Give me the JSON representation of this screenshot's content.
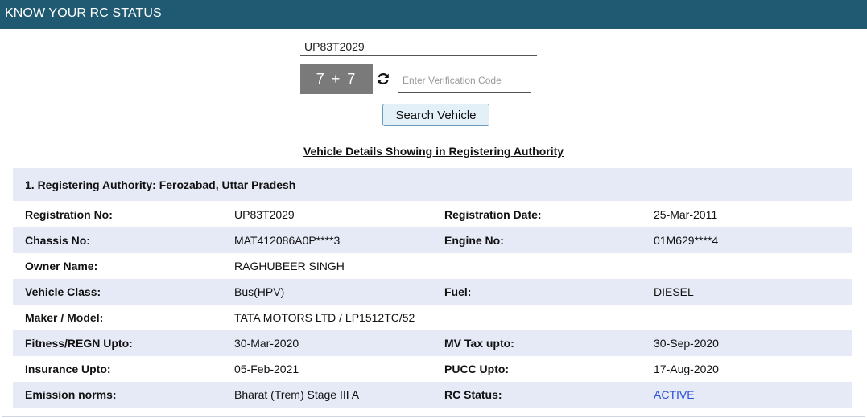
{
  "header": {
    "title": "KNOW YOUR RC STATUS"
  },
  "search": {
    "registration_value": "UP83T2029",
    "captcha_text": "7 + 7",
    "verification_placeholder": "Enter Verification Code",
    "button_label": "Search Vehicle"
  },
  "details": {
    "title": "Vehicle Details Showing in Registering Authority",
    "authority": "1. Registering Authority: Ferozabad, Uttar Pradesh",
    "rows": [
      {
        "l1": "Registration No:",
        "v1": "UP83T2029",
        "l2": "Registration Date:",
        "v2": "25-Mar-2011"
      },
      {
        "l1": "Chassis No:",
        "v1": "MAT412086A0P****3",
        "l2": "Engine No:",
        "v2": "01M629****4"
      },
      {
        "l1": "Owner Name:",
        "v1": "RAGHUBEER SINGH",
        "l2": "",
        "v2": ""
      },
      {
        "l1": "Vehicle Class:",
        "v1": "Bus(HPV)",
        "l2": "Fuel:",
        "v2": "DIESEL"
      },
      {
        "l1": "Maker / Model:",
        "v1": "TATA MOTORS LTD / LP1512TC/52",
        "l2": "",
        "v2": ""
      },
      {
        "l1": "Fitness/REGN Upto:",
        "v1": "30-Mar-2020",
        "l2": "MV Tax upto:",
        "v2": "30-Sep-2020"
      },
      {
        "l1": "Insurance Upto:",
        "v1": "05-Feb-2021",
        "l2": "PUCC Upto:",
        "v2": "17-Aug-2020"
      },
      {
        "l1": "Emission norms:",
        "v1": "Bharat (Trem) Stage III A",
        "l2": "RC Status:",
        "v2": "ACTIVE"
      }
    ]
  },
  "colors": {
    "header_bg": "#1f5a72",
    "row_shade": "#e6eaf7",
    "status_active": "#2b50d8"
  },
  "icons": {
    "refresh": "refresh-icon"
  }
}
